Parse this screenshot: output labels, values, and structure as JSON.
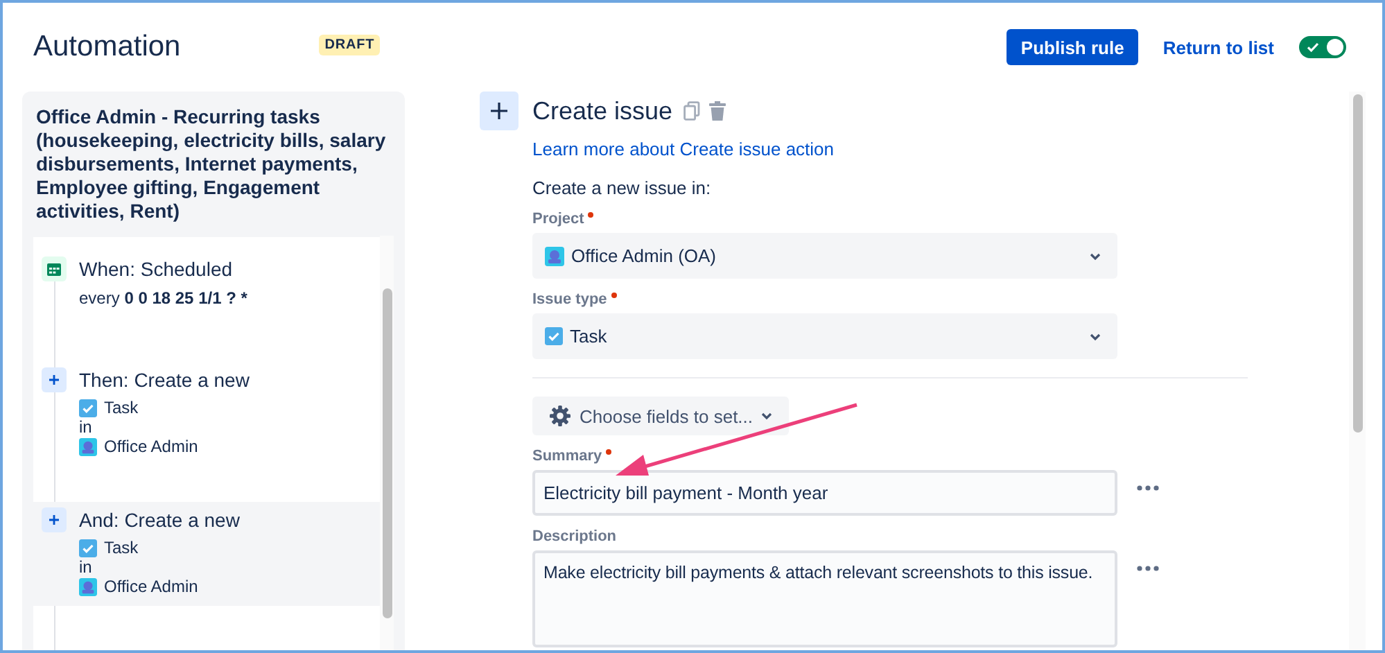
{
  "header": {
    "title": "Automation",
    "status_badge": "DRAFT",
    "publish_button": "Publish rule",
    "return_link": "Return to list",
    "rule_toggle": {
      "on": true
    }
  },
  "rule": {
    "title": "Office Admin - Recurring tasks (housekeeping, electricity bills, salary disbursements, Internet payments, Employee gifting, Engagement activities, Rent)",
    "steps": [
      {
        "kind": "trigger",
        "heading": "When: Scheduled",
        "schedule_prefix": "every",
        "schedule": "0 0 18 25 1/1 ? *",
        "selected": false
      },
      {
        "kind": "action",
        "heading": "Then: Create a new",
        "issue_type": "Task",
        "connector": "in",
        "project": "Office Admin",
        "selected": false
      },
      {
        "kind": "action",
        "heading": "And: Create a new",
        "issue_type": "Task",
        "connector": "in",
        "project": "Office Admin",
        "selected": true
      }
    ]
  },
  "editor": {
    "title": "Create issue",
    "help_link": "Learn more about Create issue action",
    "intro": "Create a new issue in:",
    "selects": [
      {
        "kind": "project",
        "label": "Project",
        "required": true,
        "value": "Office Admin (OA)"
      },
      {
        "kind": "issue_type",
        "label": "Issue type",
        "required": true,
        "value": "Task"
      }
    ],
    "choose_fields": "Choose fields to set...",
    "text_fields": [
      {
        "kind": "input",
        "label": "Summary",
        "required": true,
        "value": "Electricity bill payment - Month year"
      },
      {
        "kind": "textarea",
        "label": "Description",
        "required": false,
        "value": "Make electricity bill payments & attach relevant screenshots to this issue."
      }
    ]
  }
}
